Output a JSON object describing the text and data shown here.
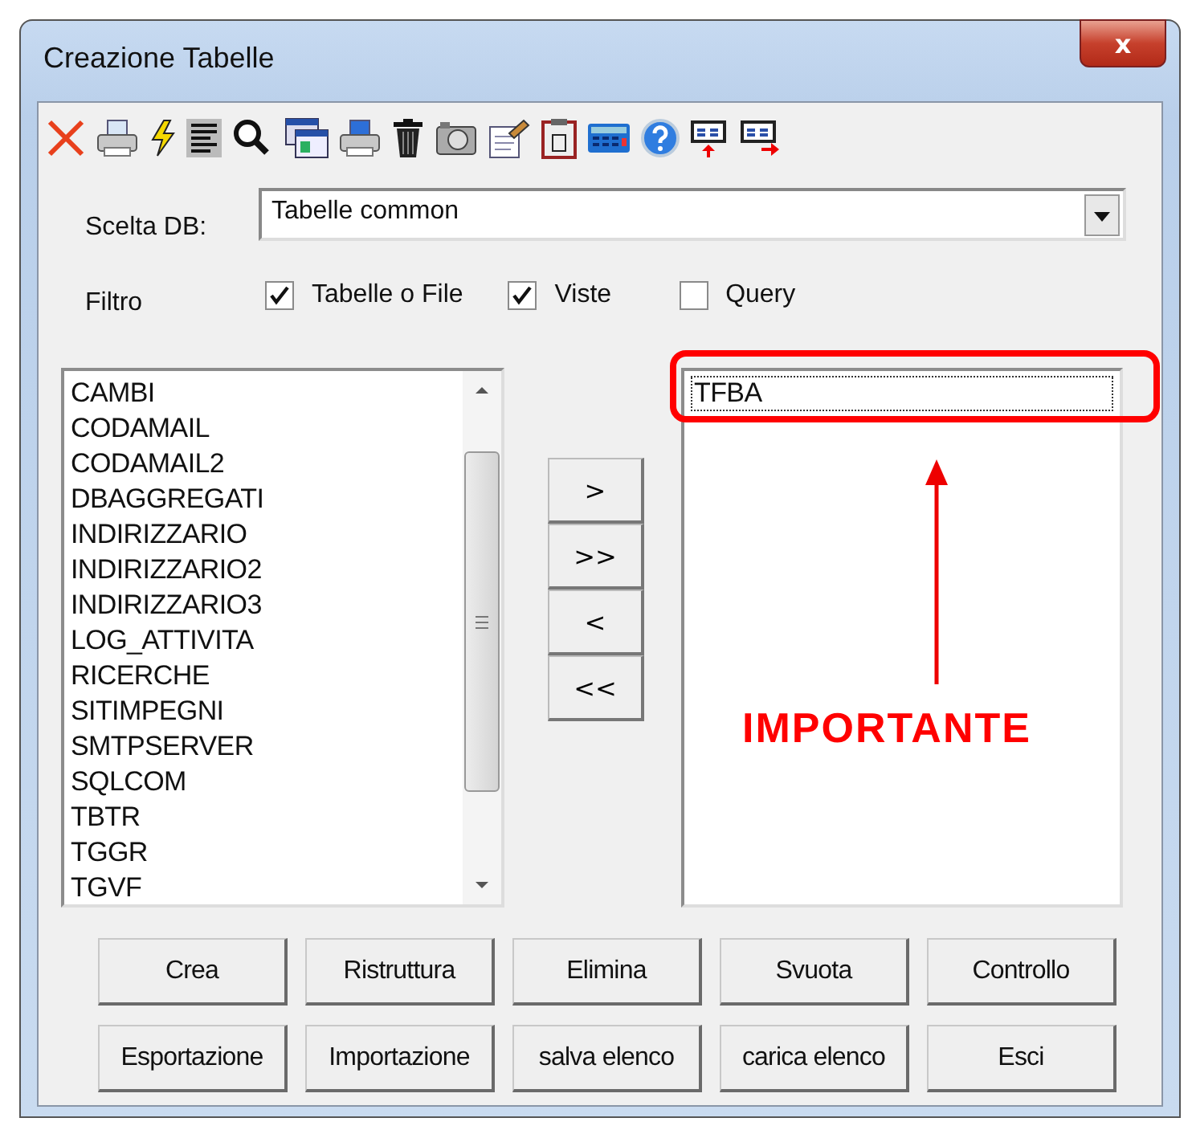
{
  "window": {
    "title": "Creazione Tabelle",
    "close_label": "x"
  },
  "toolbar": [
    {
      "kind": "delete"
    },
    {
      "kind": "print"
    },
    {
      "kind": "lightning"
    },
    {
      "kind": "text"
    },
    {
      "kind": "search"
    },
    {
      "kind": "windows"
    },
    {
      "kind": "print-blue"
    },
    {
      "kind": "trash"
    },
    {
      "kind": "camera"
    },
    {
      "kind": "notepad"
    },
    {
      "kind": "calendar"
    },
    {
      "kind": "keypad"
    },
    {
      "kind": "help"
    },
    {
      "kind": "list-up"
    },
    {
      "kind": "list-right"
    }
  ],
  "db_select": {
    "label": "Scelta DB:",
    "value": "Tabelle common"
  },
  "filter": {
    "label": "Filtro",
    "options": [
      {
        "label": "Tabelle o File",
        "checked": true
      },
      {
        "label": "Viste",
        "checked": true
      },
      {
        "label": "Query",
        "checked": false
      }
    ]
  },
  "available_tables": [
    {
      "name": "CAMBI",
      "selected": false
    },
    {
      "name": "CODAMAIL",
      "selected": false
    },
    {
      "name": "CODAMAIL2",
      "selected": false
    },
    {
      "name": "DBAGGREGATI",
      "selected": false
    },
    {
      "name": "INDIRIZZARIO",
      "selected": false
    },
    {
      "name": "INDIRIZZARIO2",
      "selected": false
    },
    {
      "name": "INDIRIZZARIO3",
      "selected": false
    },
    {
      "name": "LOG_ATTIVITA",
      "selected": false
    },
    {
      "name": "RICERCHE",
      "selected": false
    },
    {
      "name": "SITIMPEGNI",
      "selected": false
    },
    {
      "name": "SMTPSERVER",
      "selected": false
    },
    {
      "name": "SQLCOM",
      "selected": false
    },
    {
      "name": "TBTR",
      "selected": false
    },
    {
      "name": "TGGR",
      "selected": false
    },
    {
      "name": "TGVF",
      "selected": false
    }
  ],
  "move_buttons": [
    ">",
    ">>",
    "<",
    "<<"
  ],
  "chosen_tables": [
    {
      "name": "TFBA",
      "selected": true
    }
  ],
  "annotation": {
    "label": "IMPORTANTE"
  },
  "buttons": [
    [
      "Crea",
      "Ristruttura",
      "Elimina",
      "Svuota",
      "Controllo"
    ],
    [
      "Esportazione",
      "Importazione",
      "salva elenco",
      "carica elenco",
      "Esci"
    ]
  ]
}
